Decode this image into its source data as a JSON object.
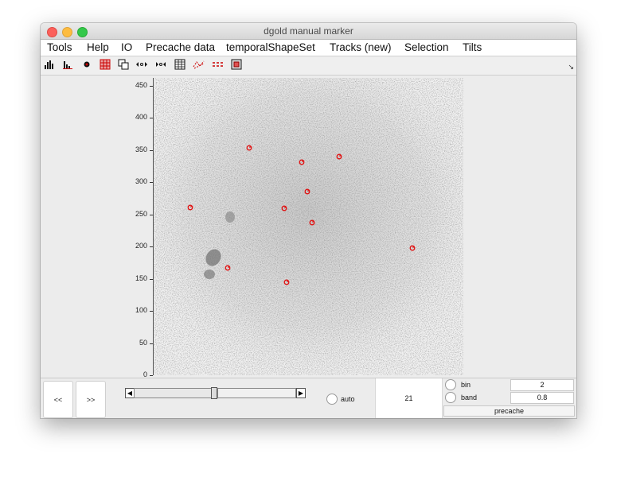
{
  "window": {
    "title": "dgold manual marker"
  },
  "menu": [
    "Tools",
    "Help",
    "IO",
    "Precache data",
    "temporalShapeSet",
    "Tracks (new)",
    "Selection",
    "Tilts"
  ],
  "toolbar": {
    "buttons": [
      {
        "name": "histogram-icon",
        "glyph": "▟"
      },
      {
        "name": "histogram-alt-icon",
        "glyph": "▙"
      },
      {
        "name": "record-dot-icon",
        "glyph": "●"
      },
      {
        "name": "grid-red-icon",
        "glyph": "▦"
      },
      {
        "name": "copy-frames-icon",
        "glyph": "⧉"
      },
      {
        "name": "move-left-right-icon",
        "glyph": "⇹"
      },
      {
        "name": "move-right-left-icon",
        "glyph": "⇺"
      },
      {
        "name": "table-icon",
        "glyph": "▤"
      },
      {
        "name": "tracks-icon",
        "glyph": "≈"
      },
      {
        "name": "tracks-dashed-icon",
        "glyph": "≋"
      },
      {
        "name": "box-red-icon",
        "glyph": "▣"
      }
    ],
    "corner_glyph": "↘"
  },
  "yaxis": {
    "ticks": [
      "450",
      "400",
      "350",
      "300",
      "250",
      "200",
      "150",
      "100",
      "50",
      "0"
    ]
  },
  "markers_note": "",
  "controls": {
    "prev_label": "<<",
    "next_label": ">>",
    "auto_label": "auto",
    "frame_number": "21",
    "bin_label": "bin",
    "bin_value": "2",
    "band_label": "band",
    "band_value": "0.8",
    "precache_label": "precache"
  }
}
